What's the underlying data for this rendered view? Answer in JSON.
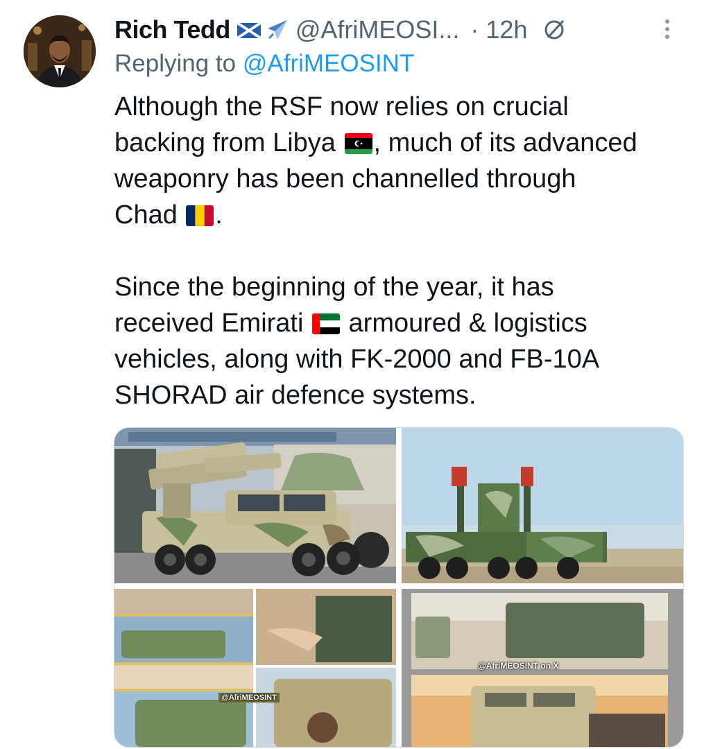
{
  "author": {
    "display_name": "Rich Tedd",
    "badges": [
      "scotland-flag-icon",
      "airplane-icon"
    ],
    "handle": "@AfriMEOSI...",
    "time": "· 12h"
  },
  "reply": {
    "prefix": "Replying to",
    "mention": "@AfriMEOSINT"
  },
  "tweet": {
    "line1": "Although the RSF now relies on crucial",
    "line2_a": "backing from Libya",
    "line2_b": ", much of its advanced",
    "line3": "weaponry has been channelled through",
    "line4_a": "Chad",
    "line4_b": ".",
    "line5": "Since the beginning of the year, it has",
    "line6_a": "received Emirati",
    "line6_b": "armoured & logistics",
    "line7": "vehicles, along with FK-2000 and FB-10A",
    "line8": "SHORAD air defence systems."
  },
  "media": {
    "watermark_1": "@AfriMEOSINT on X",
    "watermark_2": "@AfriMEOSINT"
  },
  "colors": {
    "text": "#0f1419",
    "secondary": "#536471",
    "accent": "#1d9bf0"
  }
}
